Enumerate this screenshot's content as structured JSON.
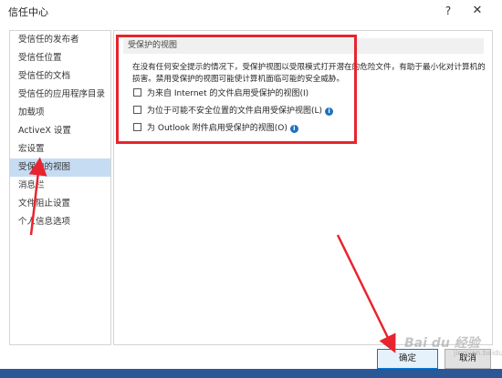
{
  "window": {
    "title": "信任中心",
    "help": "?",
    "close": "✕"
  },
  "sidebar": {
    "items": [
      {
        "label": "受信任的发布者",
        "active": false
      },
      {
        "label": "受信任位置",
        "active": false
      },
      {
        "label": "受信任的文档",
        "active": false
      },
      {
        "label": "受信任的应用程序目录",
        "active": false
      },
      {
        "label": "加载项",
        "active": false
      },
      {
        "label": "ActiveX 设置",
        "active": false
      },
      {
        "label": "宏设置",
        "active": false
      },
      {
        "label": "受保护的视图",
        "active": true
      },
      {
        "label": "消息栏",
        "active": false
      },
      {
        "label": "文件阻止设置",
        "active": false
      },
      {
        "label": "个人信息选项",
        "active": false
      }
    ]
  },
  "main": {
    "section_title": "受保护的视图",
    "description": "在没有任何安全提示的情况下，受保护视图以受限模式打开潜在的危险文件，有助于最小化对计算机的损害。禁用受保护的视图可能使计算机面临可能的安全威胁。",
    "options": [
      {
        "label": "为来自 Internet 的文件启用受保护的视图(I)",
        "checked": false,
        "info": false
      },
      {
        "label": "为位于可能不安全位置的文件启用受保护视图(L)",
        "checked": false,
        "info": true
      },
      {
        "label": "为 Outlook 附件启用受保护的视图(O)",
        "checked": false,
        "info": true
      }
    ]
  },
  "buttons": {
    "ok": "确定",
    "cancel": "取消"
  },
  "watermark": {
    "text": "Bai du 经验",
    "sub": "jingyan.baidu.com"
  },
  "colors": {
    "annotation": "#e8242e",
    "selection": "#c6dcf3",
    "accent": "#0078d7"
  }
}
